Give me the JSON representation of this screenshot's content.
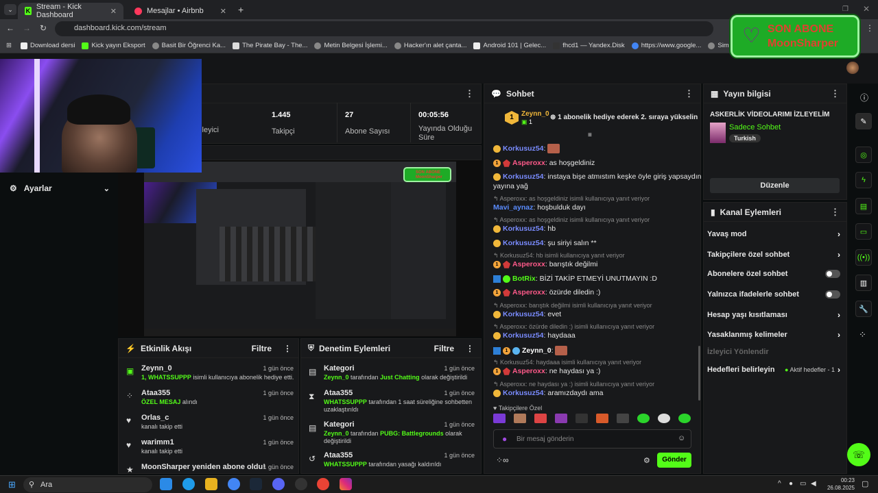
{
  "browser": {
    "tabs": [
      {
        "title": "Stream - Kick Dashboard",
        "active": true
      },
      {
        "title": "Mesajlar • Airbnb",
        "active": false
      }
    ],
    "url": "dashboard.kick.com/stream",
    "bookmarks": [
      "Download dersi",
      "Kick yayın Eksport",
      "Basit Bir Öğrenci Ka...",
      "The Pirate Bay - The...",
      "Metin Belgesi İşlemi...",
      "Hacker'ın alet çanta...",
      "Android 101 | Gelec...",
      "fhcd1 — Yandex.Disk",
      "https://www.google...",
      "Simge Çizmek ve Ka..."
    ]
  },
  "overlay": {
    "sub_title": "SON ABONE",
    "sub_name": "MoonSharper"
  },
  "stats": {
    "viewers_label": "İzleyici",
    "followers_value": "1.445",
    "followers_label": "Takipçi",
    "subs_value": "27",
    "subs_label": "Abone Sayısı",
    "duration_value": "00:05:56",
    "duration_label": "Yayında Olduğu Süre"
  },
  "sidebar": {
    "settings": "Ayarlar"
  },
  "preview": {
    "sub_title": "SON ABONE",
    "sub_name": "MoonSharper"
  },
  "activity": {
    "title": "Etkinlik Akışı",
    "filter": "Filtre",
    "items": [
      {
        "name": "Zeynn_0",
        "time": "1 gün önce",
        "highlight": "1, WHATSSUPPP",
        "desc": "isimli kullanıcıya abonelik hediye etti."
      },
      {
        "name": "Ataa355",
        "time": "1 gün önce",
        "highlight": "ÖZEL MESAJ",
        "desc": "alındı"
      },
      {
        "name": "Orlas_c",
        "time": "1 gün önce",
        "highlight": "",
        "desc": "kanalı takip etti"
      },
      {
        "name": "warimm1",
        "time": "1 gün önce",
        "highlight": "",
        "desc": "kanalı takip etti"
      },
      {
        "name": "MoonSharper yeniden abone oldu!",
        "time": "1 gün önce",
        "highlight": "",
        "desc": ""
      }
    ]
  },
  "moderation": {
    "title": "Denetim Eylemleri",
    "filter": "Filtre",
    "items": [
      {
        "name": "Kategori",
        "time": "1 gün önce",
        "u": "Zeynn_0",
        "m": "tarafından",
        "h": "Just Chatting",
        "e": "olarak değiştirildi"
      },
      {
        "name": "Ataa355",
        "time": "1 gün önce",
        "u": "WHATSSUPPP",
        "m": "tarafından 1 saat süreliğine sohbetten uzaklaştırıldı",
        "h": "",
        "e": ""
      },
      {
        "name": "Kategori",
        "time": "1 gün önce",
        "u": "Zeynn_0",
        "m": "tarafından",
        "h": "PUBG: Battlegrounds",
        "e": "olarak değiştirildi"
      },
      {
        "name": "Ataa355",
        "time": "1 gün önce",
        "u": "WHATSSUPPP",
        "m": "tarafından yasağı kaldırıldı",
        "h": "",
        "e": ""
      }
    ]
  },
  "chat": {
    "title": "Sohbet",
    "pinned_user": "Zeynn_0",
    "pinned_count": "1",
    "pinned_text": "1 abonelik hediye ederek 2. sıraya yükselin",
    "followers_only": "Takipçilere Özel",
    "input_placeholder": "Bir mesaj gönderin",
    "send": "Gönder",
    "messages": [
      {
        "user": "Korkusuz54",
        "text": ":"
      },
      {
        "user": "Asperoxx",
        "text": ": as hoşgeldiniz"
      },
      {
        "user": "Korkusuz54",
        "text": ": instaya bişe atmıstım keşke öyle giriş yapsaydın"
      },
      {
        "user": "",
        "text": "yayına yağ"
      },
      {
        "user": "",
        "text": "Asperoxx: as hoşgeldiniz isimli kullanıcıya yanıt veriyor"
      },
      {
        "user": "Mavi_aynaz",
        "text": ": hoşbulduk dayı"
      },
      {
        "user": "",
        "text": "Asperoxx: as hoşgeldiniz isimli kullanıcıya yanıt veriyor"
      },
      {
        "user": "Korkusuz54",
        "text": ": hb"
      },
      {
        "user": "Korkusuz54",
        "text": ": şu siriyi salın **"
      },
      {
        "user": "",
        "text": "Korkusuz54: hb isimli kullanıcıya yanıt veriyor"
      },
      {
        "user": "Asperoxx",
        "text": ": barıştık değilmi"
      },
      {
        "user": "BotRix",
        "text": ": BİZİ TAKİP ETMEYİ UNUTMAYIN :D"
      },
      {
        "user": "Asperoxx",
        "text": ": özürde diledin :)"
      },
      {
        "user": "",
        "text": "Asperoxx: barıştık değilmi isimli kullanıcıya yanıt veriyor"
      },
      {
        "user": "Korkusuz54",
        "text": ": evet"
      },
      {
        "user": "",
        "text": "Asperoxx: özürde diledin :) isimli kullanıcıya yanıt veriyor"
      },
      {
        "user": "Korkusuz54",
        "text": ": haydaaa"
      },
      {
        "user": "Zeynn_0",
        "text": ":"
      },
      {
        "user": "",
        "text": "Korkusuz54: haydaaa isimli kullanıcıya yanıt veriyor"
      },
      {
        "user": "Asperoxx",
        "text": ": ne haydası ya :)"
      },
      {
        "user": "",
        "text": "Asperoxx: ne haydası ya :) isimli kullanıcıya yanıt veriyor"
      },
      {
        "user": "Korkusuz54",
        "text": ": aramızdaydı ama"
      }
    ]
  },
  "stream_info": {
    "title": "Yayın bilgisi",
    "stream_title": "ASKERLİK VİDEOLARIMI İZLEYELİM",
    "category": "Sadece Sohbet",
    "language": "Turkish",
    "edit": "Düzenle"
  },
  "channel_actions": {
    "title": "Kanal Eylemleri",
    "slow": "Yavaş mod",
    "followers": "Takipçilere özel sohbet",
    "subs": "Abonelere özel sohbet",
    "emotes": "Yalnızca ifadelerle sohbet",
    "age": "Hesap yaşı kısıtlaması",
    "banned": "Yasaklanmış kelimeler",
    "raid": "İzleyici Yönlendir",
    "goals": "Hedefleri belirleyin",
    "goals_status": "Aktif hedefler - 1"
  },
  "taskbar": {
    "search": "Ara",
    "time": "00:23",
    "date": "26.08.2025"
  },
  "colors": {
    "accent": "#53fc18",
    "overlay_green": "#1eab26",
    "overlay_text": "#e0412f"
  }
}
